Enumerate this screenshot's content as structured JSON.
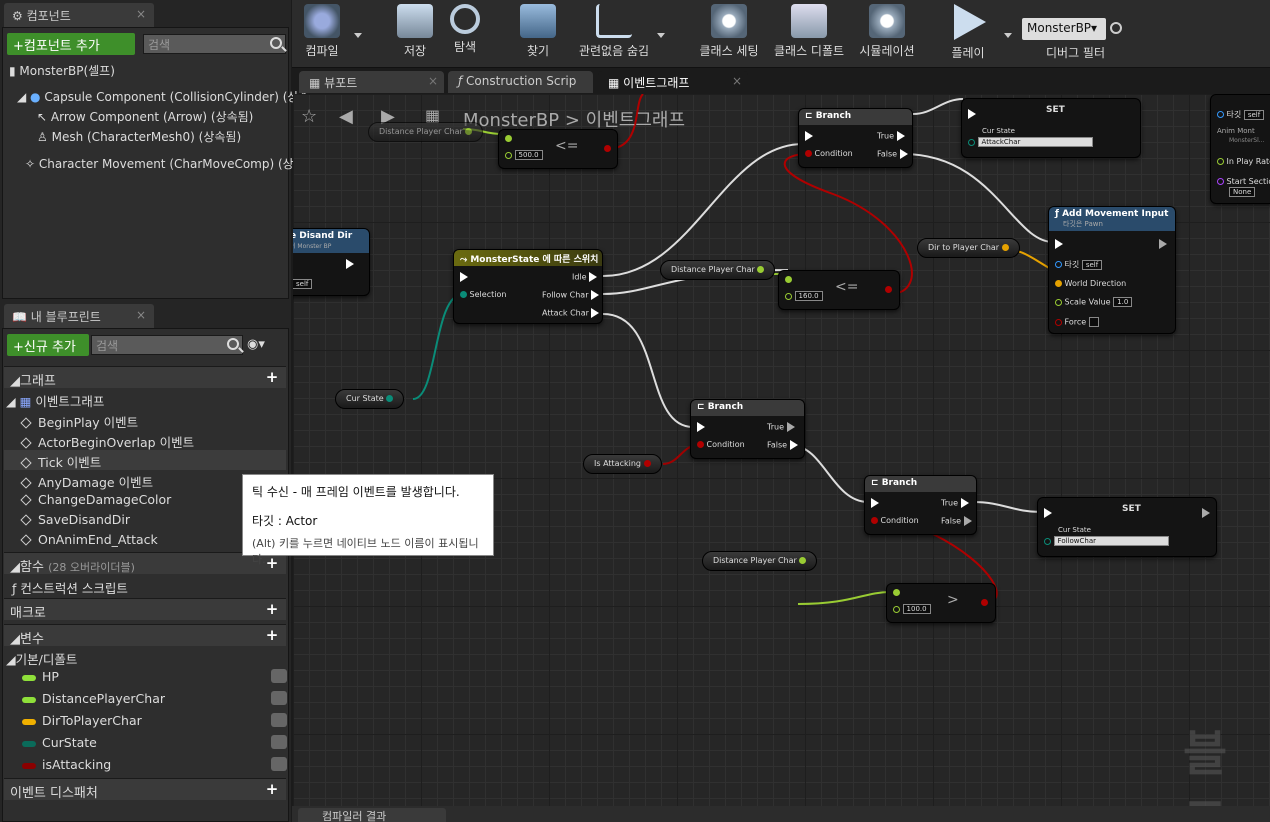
{
  "components_panel": {
    "title": "컴포넌트",
    "add_button": "+컴포넌트 추가",
    "search_placeholder": "검색",
    "root": "MonsterBP(셀프)",
    "items": [
      "Capsule Component (CollisionCylinder) (상속",
      "Arrow Component (Arrow) (상속됨)",
      "Mesh (CharacterMesh0) (상속됨)",
      "Character Movement (CharMoveComp) (상속"
    ]
  },
  "blueprint_panel": {
    "title": "내 블루프린트",
    "add_button": "+신규 추가",
    "search_placeholder": "검색",
    "graph_header": "그래프",
    "event_graph": "이벤트그래프",
    "events": [
      "BeginPlay 이벤트",
      "ActorBeginOverlap 이벤트",
      "Tick 이벤트",
      "AnyDamage 이벤트",
      "ChangeDamageColor",
      "SaveDisandDir",
      "OnAnimEnd_Attack"
    ],
    "functions_header": "함수",
    "functions_count": "(28 오버라이더블)",
    "construction_script": "컨스트럭션 스크립트",
    "macros_header": "매크로",
    "variables_header": "변수",
    "default_category": "기본/디폴트",
    "variables": [
      {
        "name": "HP",
        "color": "#8fe03a"
      },
      {
        "name": "DistancePlayerChar",
        "color": "#8fe03a"
      },
      {
        "name": "DirToPlayerChar",
        "color": "#f0b000"
      },
      {
        "name": "CurState",
        "color": "#0a6b5a"
      },
      {
        "name": "isAttacking",
        "color": "#8a0000"
      }
    ],
    "dispatchers_header": "이벤트 디스패처"
  },
  "toolbar": {
    "items": [
      "컴파일",
      "저장",
      "탐색",
      "찾기",
      "관련없음 숨김",
      "클래스 세팅",
      "클래스 디폴트",
      "시뮬레이션",
      "플레이"
    ],
    "debug_object": "MonsterBP▾",
    "debug_filter": "디버그 필터"
  },
  "doc_tabs": [
    "뷰포트",
    "Construction Scrip",
    "이벤트그래프"
  ],
  "breadcrumb": {
    "bp": "MonsterBP",
    "sep": ">",
    "graph": "이벤트그래프"
  },
  "nodes": {
    "branch": "Branch",
    "true": "True",
    "false": "False",
    "condition": "Condition",
    "set": "SET",
    "cur_state": "Cur State",
    "attack_char": "AttackChar",
    "follow_char": "FollowChar",
    "switch_title": "MonsterState 에 따른 스위치",
    "selection": "Selection",
    "idle": "Idle",
    "follow": "Follow Char",
    "attack": "Attack Char",
    "add_move": "Add Movement Input",
    "add_move_sub": "타깃은 Pawn",
    "target": "타깃",
    "self": "self",
    "world_dir": "World Direction",
    "scale_value": "Scale Value",
    "scale_val": "1.0",
    "force": "Force",
    "dist": "Distance Player Char",
    "dir": "Dir to Player Char",
    "curstate_var": "Cur State",
    "isatt": "Is Attacking",
    "v500": "500.0",
    "v160": "160.0",
    "v100": "100.0",
    "le": "<=",
    "gt": ">",
    "save_disand": "e Disand Dir",
    "save_sub": "이 Monster BP",
    "anim_mont": "Anim Mont",
    "anim_sub": "MonsterSl...",
    "in_play": "In Play Rate",
    "start_sec": "Start Sectio",
    "none": "None"
  },
  "tooltip": {
    "line1": "틱 수신 - 매 프레임 이벤트를 발생합니다.",
    "line2": "타깃 : Actor",
    "line3": "(Alt) 키를 누르면 네이티브 노드 이름이 표시됩니다."
  },
  "watermark": "블루",
  "bottom_tab": "컴파일러 결과"
}
